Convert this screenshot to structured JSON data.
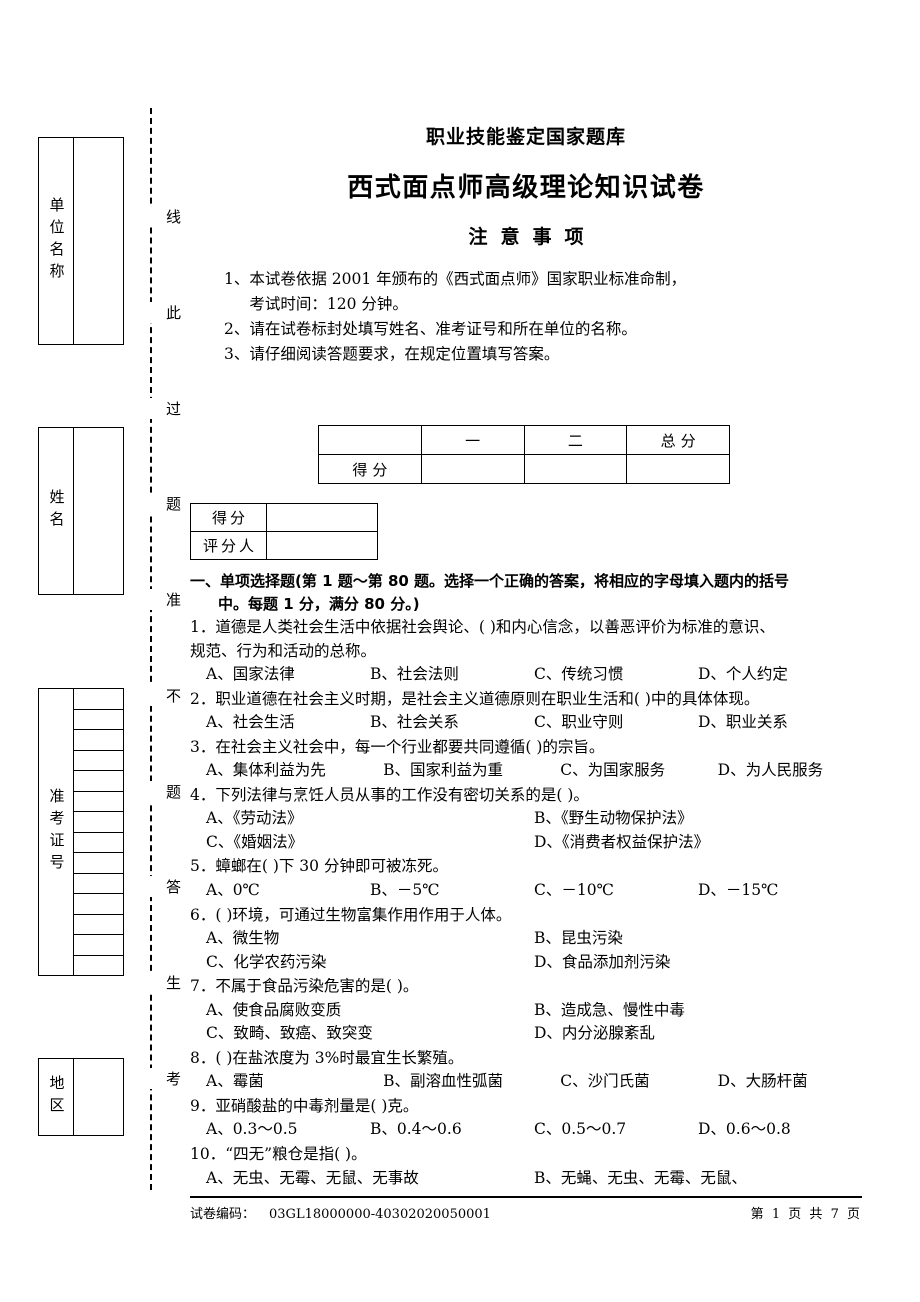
{
  "header": {
    "line1": "职业技能鉴定国家题库",
    "line2": "西式面点师高级理论知识试卷",
    "line3": "注意事项"
  },
  "notice": [
    {
      "num": "1、",
      "text": "本试卷依据 2001 年颁布的《西式面点师》国家职业标准命制，",
      "text2": "考试时间：120 分钟。"
    },
    {
      "num": "2、",
      "text": "请在试卷标封处填写姓名、准考证号和所在单位的名称。"
    },
    {
      "num": "3、",
      "text": "请仔细阅读答题要求，在规定位置填写答案。"
    }
  ],
  "stubs": {
    "unit_name": "单位名称",
    "person_name": "姓名",
    "ticket_number": "准考证号",
    "region": "地区",
    "ticket_cell_count": 14
  },
  "seal_line_chars": [
    "线",
    "此",
    "过",
    "题",
    "准",
    "不",
    "题",
    "答",
    "生",
    "考"
  ],
  "score_table": {
    "headers": [
      "",
      "一",
      "二",
      "总分"
    ],
    "row_label": "得分",
    "row_values": [
      "",
      "",
      ""
    ]
  },
  "marker_table": {
    "rows": [
      {
        "label": "得分",
        "value": ""
      },
      {
        "label": "评分人",
        "value": ""
      }
    ]
  },
  "section": {
    "title_line1": "一、单项选择题(第 1 题～第 80 题。选择一个正确的答案，将相应的字母填入题内的括号",
    "title_line2": "中。每题 1 分，满分 80 分。)"
  },
  "questions": [
    {
      "stem_l1": "1．道德是人类社会生活中依据社会舆论、(       )和内心信念，以善恶评价为标准的意识、",
      "stem_l2": "规范、行为和活动的总称。",
      "cols": 4,
      "options": [
        "A、国家法律",
        "B、社会法则",
        "C、传统习惯",
        "D、个人约定"
      ]
    },
    {
      "stem_l1": "2．职业道德在社会主义时期，是社会主义道德原则在职业生活和(       )中的具体体现。",
      "cols": 4,
      "options": [
        "A、社会生活",
        "B、社会关系",
        "C、职业守则",
        "D、职业关系"
      ]
    },
    {
      "stem_l1": "3．在社会主义社会中，每一个行业都要共同遵循(       )的宗旨。",
      "cols": 4,
      "options": [
        "A、集体利益为先",
        "B、国家利益为重",
        "C、为国家服务",
        "D、为人民服务"
      ]
    },
    {
      "stem_l1": "4．下列法律与烹饪人员从事的工作没有密切关系的是(       )。",
      "cols": 2,
      "options": [
        "A、《劳动法》",
        "B、《野生动物保护法》",
        "C、《婚姻法》",
        "D、《消费者权益保护法》"
      ]
    },
    {
      "stem_l1": "5．蟑螂在(       )下 30 分钟即可被冻死。",
      "cols": 4,
      "options": [
        "A、0℃",
        "B、－5℃",
        "C、－10℃",
        "D、－15℃"
      ]
    },
    {
      "stem_l1": "6．(       )环境，可通过生物富集作用作用于人体。",
      "cols": 2,
      "options": [
        "A、微生物",
        "B、昆虫污染",
        "C、化学农药污染",
        "D、食品添加剂污染"
      ]
    },
    {
      "stem_l1": "7．不属于食品污染危害的是(       )。",
      "cols": 2,
      "options": [
        "A、使食品腐败变质",
        "B、造成急、慢性中毒",
        "C、致畸、致癌、致突变",
        "D、内分泌腺紊乱"
      ]
    },
    {
      "stem_l1": "8．(       )在盐浓度为 3%时最宜生长繁殖。",
      "cols": 4,
      "options": [
        "A、霉菌",
        "B、副溶血性弧菌",
        "C、沙门氏菌",
        "D、大肠杆菌"
      ]
    },
    {
      "stem_l1": "9．亚硝酸盐的中毒剂量是(       )克。",
      "cols": 4,
      "options": [
        "A、0.3～0.5",
        "B、0.4～0.6",
        "C、0.5～0.7",
        "D、0.6～0.8"
      ]
    },
    {
      "stem_l1": "10．“四无”粮仓是指(       )。",
      "cols": 2,
      "options": [
        "A、无虫、无霉、无鼠、无事故",
        "B、无蝇、无虫、无霉、无鼠、"
      ]
    }
  ],
  "footer": {
    "code_label": "试卷编码：",
    "code_value": "03GL18000000-40302020050001",
    "page_prefix": "第",
    "page_current": "1",
    "page_unit1": "页",
    "page_total_prefix": "共",
    "page_total": "7",
    "page_unit2": "页"
  }
}
